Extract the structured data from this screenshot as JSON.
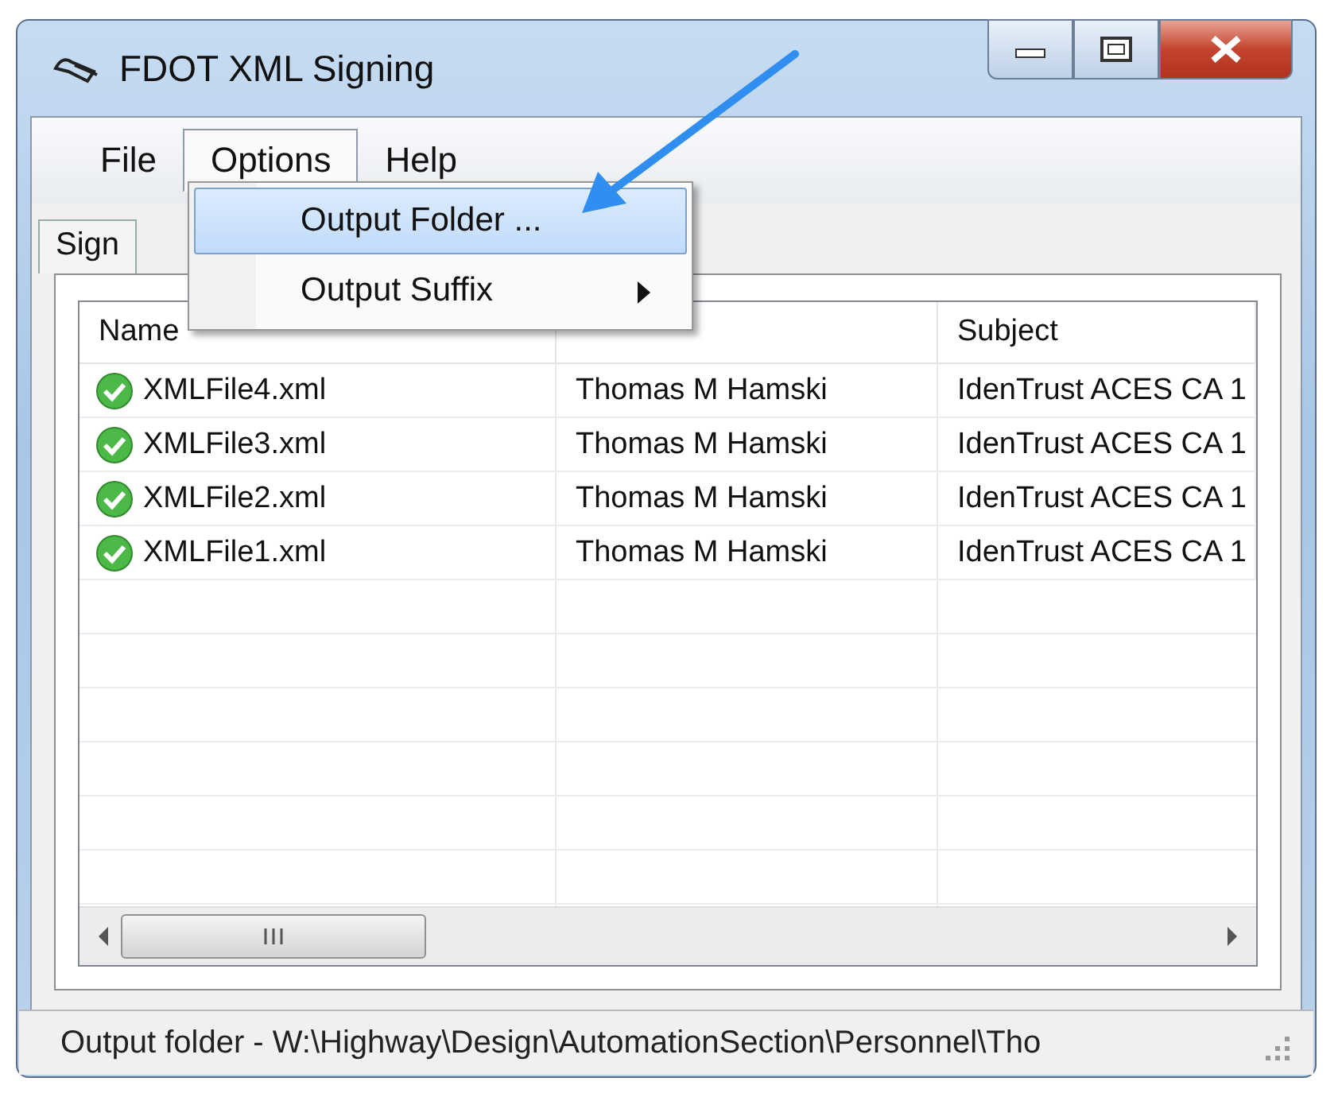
{
  "window": {
    "title": "FDOT XML Signing"
  },
  "menu": [
    {
      "label": "File",
      "selected": false
    },
    {
      "label": "Options",
      "selected": true
    },
    {
      "label": "Help",
      "selected": false
    }
  ],
  "dropdown": [
    {
      "label": "Output Folder ...",
      "selected": true,
      "submenu": false
    },
    {
      "label": "Output Suffix",
      "selected": false,
      "submenu": true
    }
  ],
  "tabs": [
    {
      "label": "Sign",
      "selected": true
    }
  ],
  "table": {
    "columns": [
      "Name",
      "",
      "Subject"
    ],
    "rows": [
      {
        "name": "XMLFile4.xml",
        "signer": "Thomas M Hamski",
        "subject": "IdenTrust ACES CA 1"
      },
      {
        "name": "XMLFile3.xml",
        "signer": "Thomas M Hamski",
        "subject": "IdenTrust ACES CA 1"
      },
      {
        "name": "XMLFile2.xml",
        "signer": "Thomas M Hamski",
        "subject": "IdenTrust ACES CA 1"
      },
      {
        "name": "XMLFile1.xml",
        "signer": "Thomas M Hamski",
        "subject": "IdenTrust ACES CA 1"
      }
    ]
  },
  "status_bar": "Output folder - W:\\Highway\\Design\\AutomationSection\\Personnel\\Tho"
}
